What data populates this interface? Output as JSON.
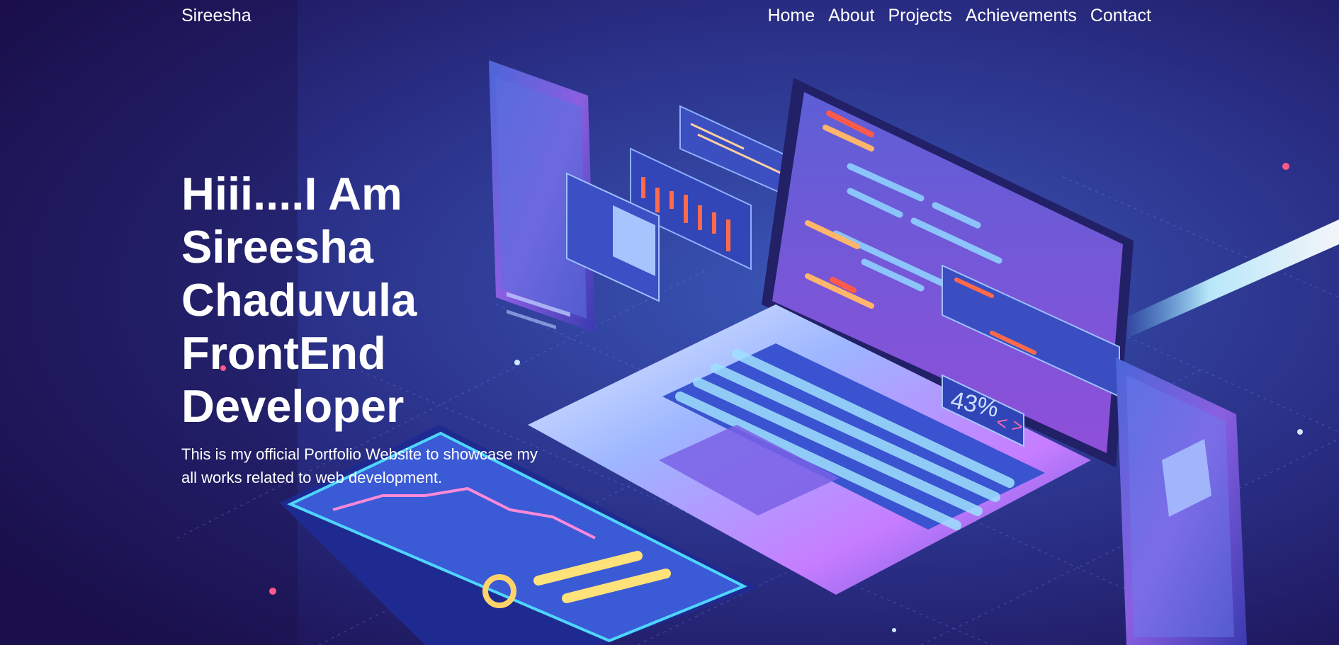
{
  "nav": {
    "brand": "Sireesha",
    "links": [
      "Home",
      "About",
      "Projects",
      "Achievements",
      "Contact"
    ]
  },
  "hero": {
    "title_lines": [
      "Hiii....I Am",
      "Sireesha",
      "Chaduvula",
      "FrontEnd",
      "Developer"
    ],
    "subtitle": "This is my official Portfolio Website to showcase my all works related to web development."
  },
  "illustration": {
    "badge_percent": "43%",
    "badge_code": "< >"
  },
  "colors": {
    "bg_dark": "#1a1550",
    "bg_mid": "#2b3a8f",
    "accent_cyan": "#4fd6ff",
    "accent_pink": "#ff5fc8",
    "accent_orange": "#ff7a4a",
    "text": "#ffffff"
  }
}
